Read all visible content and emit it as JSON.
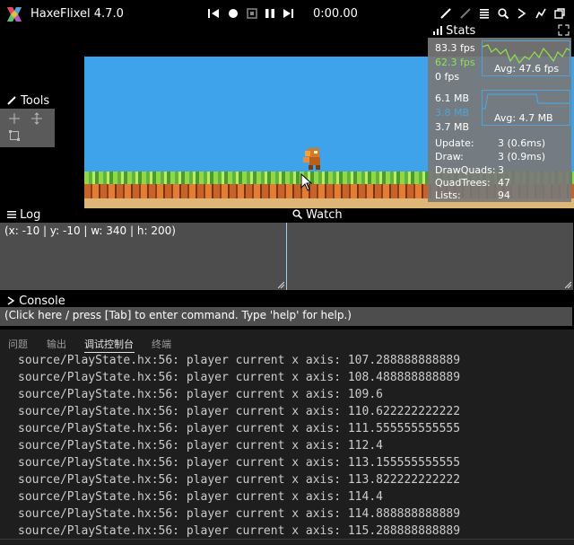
{
  "window": {
    "title": "HaxeFlixel 4.7.0"
  },
  "playback": {
    "time": "0:00.00"
  },
  "tools": {
    "label": "Tools"
  },
  "stats": {
    "label": "Stats",
    "fps_current": "83.3 fps",
    "fps_avg_line": "62.3 fps",
    "fps_zero": "0 fps",
    "fps_avg_label": "Avg: 47.6 fps",
    "mem_a": "6.1 MB",
    "mem_b": "3.8 MB",
    "mem_c": "3.7 MB",
    "mem_avg_label": "Avg: 4.7 MB",
    "update_label": "Update:",
    "update_value": "3 (0.6ms)",
    "draw_label": "Draw:",
    "draw_value": "3 (0.9ms)",
    "drawquads_label": "DrawQuads:",
    "drawquads_value": "3",
    "quadtrees_label": "QuadTrees:",
    "quadtrees_value": "47",
    "lists_label": "Lists:",
    "lists_value": "94",
    "colors": {
      "fps_avg": "#8fe34a",
      "mem_b": "#4fa3d8"
    }
  },
  "log": {
    "label": "Log",
    "text": "(x: -10 | y: -10 | w: 340 | h: 200)"
  },
  "watch": {
    "label": "Watch"
  },
  "console": {
    "label": "Console",
    "text": "(Click here / press [Tab] to enter command. Type 'help' for help.)"
  },
  "vscode": {
    "tabs": [
      "问题",
      "输出",
      "调试控制台",
      "终端"
    ],
    "active_tab": 2,
    "lines": [
      "source/PlayState.hx:56: player current x axis: 107.288888888889",
      "source/PlayState.hx:56: player current x axis: 108.488888888889",
      "source/PlayState.hx:56: player current x axis: 109.6",
      "source/PlayState.hx:56: player current x axis: 110.622222222222",
      "source/PlayState.hx:56: player current x axis: 111.555555555555",
      "source/PlayState.hx:56: player current x axis: 112.4",
      "source/PlayState.hx:56: player current x axis: 113.155555555555",
      "source/PlayState.hx:56: player current x axis: 113.822222222222",
      "source/PlayState.hx:56: player current x axis: 114.4",
      "source/PlayState.hx:56: player current x axis: 114.888888888889",
      "source/PlayState.hx:56: player current x axis: 115.288888888889"
    ]
  }
}
